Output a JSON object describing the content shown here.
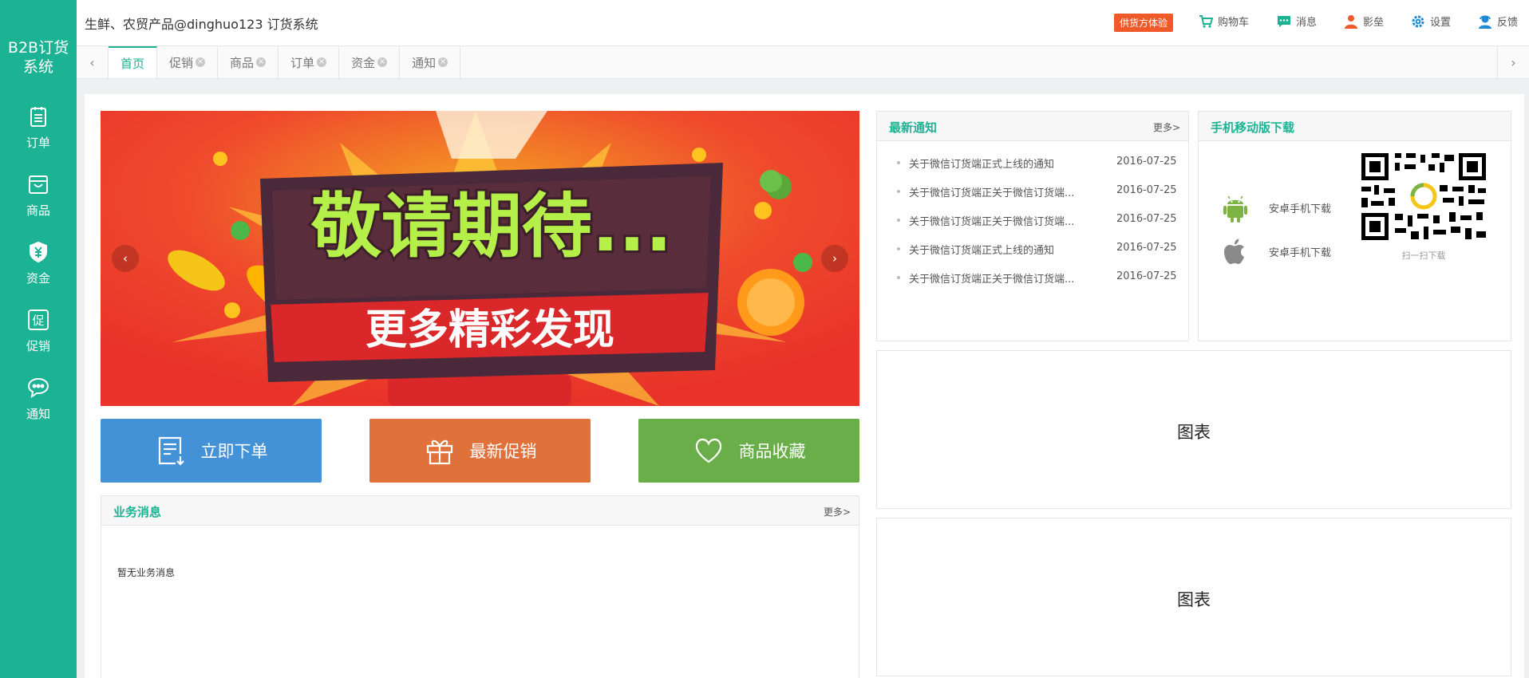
{
  "app": {
    "brand": "B2B订货系统",
    "brand_line1": "B2B订货",
    "brand_line2": "系统",
    "title": "生鲜、农贸产品@dinghuo123 订货系统"
  },
  "sidebar": {
    "items": [
      {
        "label": "订单",
        "icon": "clipboard-icon"
      },
      {
        "label": "商品",
        "icon": "shopping-bag-icon"
      },
      {
        "label": "资金",
        "icon": "yuan-shield-icon"
      },
      {
        "label": "促销",
        "icon": "promo-tag-icon"
      },
      {
        "label": "通知",
        "icon": "chat-bubble-icon"
      }
    ]
  },
  "topbar": {
    "badge": "供货方体验",
    "cart": "购物车",
    "messages": "消息",
    "user": "影垒",
    "settings": "设置",
    "feedback": "反馈"
  },
  "tabs": [
    {
      "label": "首页",
      "active": true,
      "closable": false
    },
    {
      "label": "促销",
      "active": false,
      "closable": true
    },
    {
      "label": "商品",
      "active": false,
      "closable": true
    },
    {
      "label": "订单",
      "active": false,
      "closable": true
    },
    {
      "label": "资金",
      "active": false,
      "closable": true
    },
    {
      "label": "通知",
      "active": false,
      "closable": true
    }
  ],
  "banner": {
    "headline": "敬请期待...",
    "subline": "更多精彩发现"
  },
  "quick_actions": [
    {
      "label": "立即下单",
      "color": "#4391d6",
      "icon": "order-list-icon"
    },
    {
      "label": "最新促销",
      "color": "#e1713a",
      "icon": "gift-icon"
    },
    {
      "label": "商品收藏",
      "color": "#6aae4a",
      "icon": "heart-icon"
    }
  ],
  "business": {
    "title": "业务消息",
    "more": "更多>",
    "empty": "暂无业务消息"
  },
  "notices": {
    "title": "最新通知",
    "more": "更多>",
    "items": [
      {
        "text": "关于微信订货端正式上线的通知",
        "date": "2016-07-25"
      },
      {
        "text": "关于微信订货端正关于微信订货端...",
        "date": "2016-07-25"
      },
      {
        "text": "关于微信订货端正关于微信订货端...",
        "date": "2016-07-25"
      },
      {
        "text": "关于微信订货端正式上线的通知",
        "date": "2016-07-25"
      },
      {
        "text": "关于微信订货端正关于微信订货端...",
        "date": "2016-07-25"
      }
    ]
  },
  "mobile": {
    "title": "手机移动版下载",
    "android": "安卓手机下载",
    "ios": "安卓手机下载",
    "qr_caption": "扫一扫下载"
  },
  "charts": {
    "placeholder_1": "图表",
    "placeholder_2": "图表"
  },
  "colors": {
    "accent": "#1cb394",
    "badge": "#f0592a"
  }
}
